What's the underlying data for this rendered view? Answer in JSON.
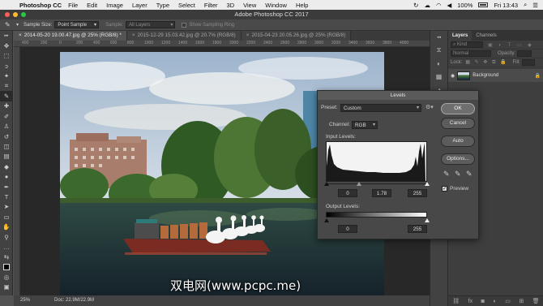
{
  "menubar": {
    "app_name": "Photoshop CC",
    "items": [
      "File",
      "Edit",
      "Image",
      "Layer",
      "Type",
      "Select",
      "Filter",
      "3D",
      "View",
      "Window",
      "Help"
    ],
    "battery": "100%",
    "clock": "Fri 13:43"
  },
  "window": {
    "title": "Adobe Photoshop CC 2017"
  },
  "options_bar": {
    "sample_size_label": "Sample Size:",
    "sample_size_value": "Point Sample",
    "sample_label": "Sample:",
    "sample_value": "All Layers",
    "show_ring_label": "Show Sampling Ring"
  },
  "tabs": [
    {
      "label": "2014-05-20 19.00.47.jpg @ 25% (RGB/8) *"
    },
    {
      "label": "2015-12-29 15.03.42.jpg @ 20.7% (RGB/8)"
    },
    {
      "label": "2015-04-23 20.05.26.jpg @ 25% (RGB/8)"
    }
  ],
  "ruler_marks": [
    "400",
    "200",
    "0",
    "200",
    "400",
    "600",
    "800",
    "1000",
    "1200",
    "1400",
    "1600",
    "1800",
    "2000",
    "2200",
    "2400",
    "2600",
    "2800",
    "3000",
    "3200",
    "3400",
    "3600",
    "3800",
    "4000"
  ],
  "status": {
    "zoom": "25%",
    "doc": "Doc: 22.9M/22.9M"
  },
  "layers_panel": {
    "tab_layers": "Layers",
    "tab_channels": "Channels",
    "filter_kind": "Kind",
    "blend_mode": "Normal",
    "opacity_label": "Opacity:",
    "lock_label": "Lock:",
    "fill_label": "Fill:",
    "layer_name": "Background"
  },
  "levels": {
    "title": "Levels",
    "preset_label": "Preset:",
    "preset_value": "Custom",
    "channel_label": "Channel:",
    "channel_value": "RGB",
    "input_label": "Input Levels:",
    "input_black": "0",
    "input_gamma": "1.78",
    "input_white": "255",
    "output_label": "Output Levels:",
    "output_black": "0",
    "output_white": "255",
    "buttons": {
      "ok": "OK",
      "cancel": "Cancel",
      "auto": "Auto",
      "options": "Options..."
    },
    "preview_label": "Preview",
    "preview_checked": true
  },
  "watermark": "双电网(www.pcpc.me)"
}
